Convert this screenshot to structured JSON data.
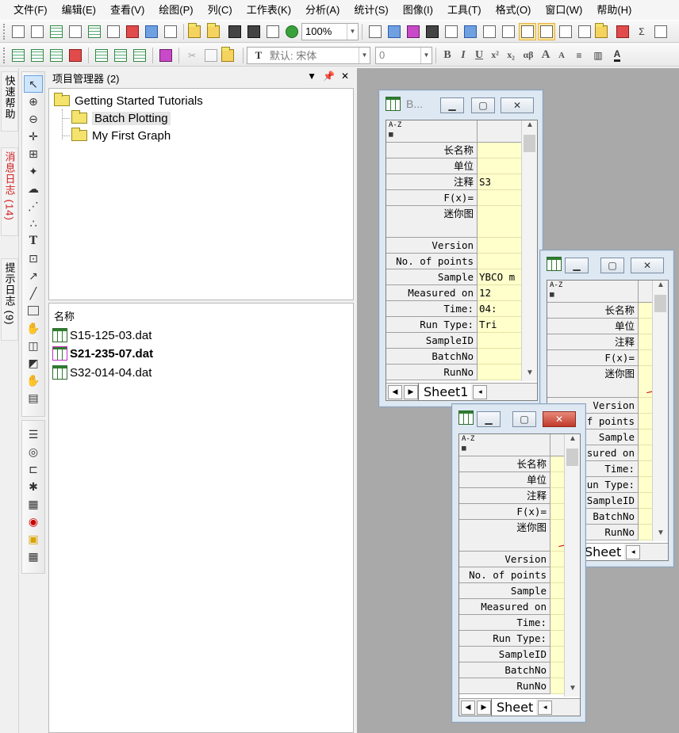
{
  "menu": [
    "文件(F)",
    "编辑(E)",
    "查看(V)",
    "绘图(P)",
    "列(C)",
    "工作表(K)",
    "分析(A)",
    "统计(S)",
    "图像(I)",
    "工具(T)",
    "格式(O)",
    "窗口(W)",
    "帮助(H)"
  ],
  "toolbar": {
    "zoom_value": "100%",
    "font_name": "默认: 宋体",
    "font_size": "0",
    "fmt_bold": "B",
    "fmt_italic": "I",
    "fmt_underline": "U",
    "fmt_super": "x²",
    "fmt_sub": "x₂",
    "fmt_greek": "αβ",
    "fmt_bigger": "A",
    "fmt_smaller": "A",
    "sigma": "Σ"
  },
  "dock_tabs": {
    "quick_help": "快速帮助",
    "message_log": "消息日志 (14)",
    "hint_log": "提示日志 (9)"
  },
  "project_explorer": {
    "title": "项目管理器 (2)",
    "tree": [
      {
        "label": "Getting Started Tutorials"
      },
      {
        "label": "Batch Plotting"
      },
      {
        "label": "My First Graph"
      }
    ],
    "list_header": "名称",
    "files": [
      "S15-125-03.dat",
      "S21-235-07.dat",
      "S32-014-04.dat"
    ]
  },
  "workbook": {
    "title_partial": "B...",
    "sheet_tab": "Sheet1",
    "sheet_tab_short": "Sheet",
    "row_labels": [
      "长名称",
      "单位",
      "注释",
      "F(x)=",
      "迷你图",
      "Version",
      "No. of points",
      "Sample",
      "Measured on",
      "Time:",
      "Run Type:",
      "SampleID",
      "BatchNo",
      "RunNo"
    ],
    "row_labels_w2": [
      "长名称",
      "单位",
      "注释",
      "F(x)=",
      "迷你图",
      "Version",
      "f points",
      "Sample",
      "sured on",
      "Time:",
      "un Type:",
      "SampleID",
      "BatchNo",
      "RunNo"
    ],
    "col1_values": [
      "",
      "",
      "S3",
      "",
      "",
      "",
      "",
      "YBCO m",
      "12",
      "04:",
      "Tri",
      "",
      "",
      ""
    ]
  }
}
